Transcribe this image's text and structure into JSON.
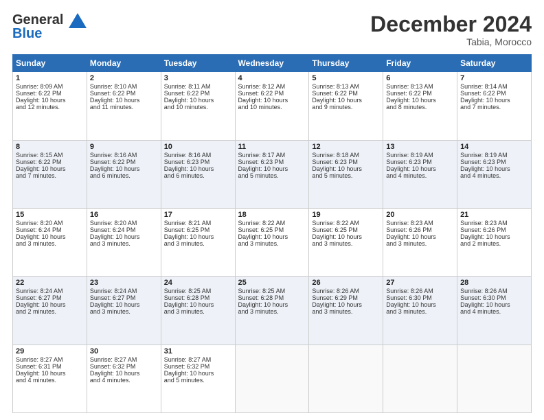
{
  "logo": {
    "line1": "General",
    "line2": "Blue"
  },
  "header": {
    "month": "December 2024",
    "location": "Tabia, Morocco"
  },
  "weekdays": [
    "Sunday",
    "Monday",
    "Tuesday",
    "Wednesday",
    "Thursday",
    "Friday",
    "Saturday"
  ],
  "weeks": [
    [
      {
        "day": "1",
        "lines": [
          "Sunrise: 8:09 AM",
          "Sunset: 6:22 PM",
          "Daylight: 10 hours",
          "and 12 minutes."
        ]
      },
      {
        "day": "2",
        "lines": [
          "Sunrise: 8:10 AM",
          "Sunset: 6:22 PM",
          "Daylight: 10 hours",
          "and 11 minutes."
        ]
      },
      {
        "day": "3",
        "lines": [
          "Sunrise: 8:11 AM",
          "Sunset: 6:22 PM",
          "Daylight: 10 hours",
          "and 10 minutes."
        ]
      },
      {
        "day": "4",
        "lines": [
          "Sunrise: 8:12 AM",
          "Sunset: 6:22 PM",
          "Daylight: 10 hours",
          "and 10 minutes."
        ]
      },
      {
        "day": "5",
        "lines": [
          "Sunrise: 8:13 AM",
          "Sunset: 6:22 PM",
          "Daylight: 10 hours",
          "and 9 minutes."
        ]
      },
      {
        "day": "6",
        "lines": [
          "Sunrise: 8:13 AM",
          "Sunset: 6:22 PM",
          "Daylight: 10 hours",
          "and 8 minutes."
        ]
      },
      {
        "day": "7",
        "lines": [
          "Sunrise: 8:14 AM",
          "Sunset: 6:22 PM",
          "Daylight: 10 hours",
          "and 7 minutes."
        ]
      }
    ],
    [
      {
        "day": "8",
        "lines": [
          "Sunrise: 8:15 AM",
          "Sunset: 6:22 PM",
          "Daylight: 10 hours",
          "and 7 minutes."
        ]
      },
      {
        "day": "9",
        "lines": [
          "Sunrise: 8:16 AM",
          "Sunset: 6:22 PM",
          "Daylight: 10 hours",
          "and 6 minutes."
        ]
      },
      {
        "day": "10",
        "lines": [
          "Sunrise: 8:16 AM",
          "Sunset: 6:23 PM",
          "Daylight: 10 hours",
          "and 6 minutes."
        ]
      },
      {
        "day": "11",
        "lines": [
          "Sunrise: 8:17 AM",
          "Sunset: 6:23 PM",
          "Daylight: 10 hours",
          "and 5 minutes."
        ]
      },
      {
        "day": "12",
        "lines": [
          "Sunrise: 8:18 AM",
          "Sunset: 6:23 PM",
          "Daylight: 10 hours",
          "and 5 minutes."
        ]
      },
      {
        "day": "13",
        "lines": [
          "Sunrise: 8:19 AM",
          "Sunset: 6:23 PM",
          "Daylight: 10 hours",
          "and 4 minutes."
        ]
      },
      {
        "day": "14",
        "lines": [
          "Sunrise: 8:19 AM",
          "Sunset: 6:23 PM",
          "Daylight: 10 hours",
          "and 4 minutes."
        ]
      }
    ],
    [
      {
        "day": "15",
        "lines": [
          "Sunrise: 8:20 AM",
          "Sunset: 6:24 PM",
          "Daylight: 10 hours",
          "and 3 minutes."
        ]
      },
      {
        "day": "16",
        "lines": [
          "Sunrise: 8:20 AM",
          "Sunset: 6:24 PM",
          "Daylight: 10 hours",
          "and 3 minutes."
        ]
      },
      {
        "day": "17",
        "lines": [
          "Sunrise: 8:21 AM",
          "Sunset: 6:25 PM",
          "Daylight: 10 hours",
          "and 3 minutes."
        ]
      },
      {
        "day": "18",
        "lines": [
          "Sunrise: 8:22 AM",
          "Sunset: 6:25 PM",
          "Daylight: 10 hours",
          "and 3 minutes."
        ]
      },
      {
        "day": "19",
        "lines": [
          "Sunrise: 8:22 AM",
          "Sunset: 6:25 PM",
          "Daylight: 10 hours",
          "and 3 minutes."
        ]
      },
      {
        "day": "20",
        "lines": [
          "Sunrise: 8:23 AM",
          "Sunset: 6:26 PM",
          "Daylight: 10 hours",
          "and 3 minutes."
        ]
      },
      {
        "day": "21",
        "lines": [
          "Sunrise: 8:23 AM",
          "Sunset: 6:26 PM",
          "Daylight: 10 hours",
          "and 2 minutes."
        ]
      }
    ],
    [
      {
        "day": "22",
        "lines": [
          "Sunrise: 8:24 AM",
          "Sunset: 6:27 PM",
          "Daylight: 10 hours",
          "and 2 minutes."
        ]
      },
      {
        "day": "23",
        "lines": [
          "Sunrise: 8:24 AM",
          "Sunset: 6:27 PM",
          "Daylight: 10 hours",
          "and 3 minutes."
        ]
      },
      {
        "day": "24",
        "lines": [
          "Sunrise: 8:25 AM",
          "Sunset: 6:28 PM",
          "Daylight: 10 hours",
          "and 3 minutes."
        ]
      },
      {
        "day": "25",
        "lines": [
          "Sunrise: 8:25 AM",
          "Sunset: 6:28 PM",
          "Daylight: 10 hours",
          "and 3 minutes."
        ]
      },
      {
        "day": "26",
        "lines": [
          "Sunrise: 8:26 AM",
          "Sunset: 6:29 PM",
          "Daylight: 10 hours",
          "and 3 minutes."
        ]
      },
      {
        "day": "27",
        "lines": [
          "Sunrise: 8:26 AM",
          "Sunset: 6:30 PM",
          "Daylight: 10 hours",
          "and 3 minutes."
        ]
      },
      {
        "day": "28",
        "lines": [
          "Sunrise: 8:26 AM",
          "Sunset: 6:30 PM",
          "Daylight: 10 hours",
          "and 4 minutes."
        ]
      }
    ],
    [
      {
        "day": "29",
        "lines": [
          "Sunrise: 8:27 AM",
          "Sunset: 6:31 PM",
          "Daylight: 10 hours",
          "and 4 minutes."
        ]
      },
      {
        "day": "30",
        "lines": [
          "Sunrise: 8:27 AM",
          "Sunset: 6:32 PM",
          "Daylight: 10 hours",
          "and 4 minutes."
        ]
      },
      {
        "day": "31",
        "lines": [
          "Sunrise: 8:27 AM",
          "Sunset: 6:32 PM",
          "Daylight: 10 hours",
          "and 5 minutes."
        ]
      },
      {
        "day": "",
        "lines": []
      },
      {
        "day": "",
        "lines": []
      },
      {
        "day": "",
        "lines": []
      },
      {
        "day": "",
        "lines": []
      }
    ]
  ]
}
